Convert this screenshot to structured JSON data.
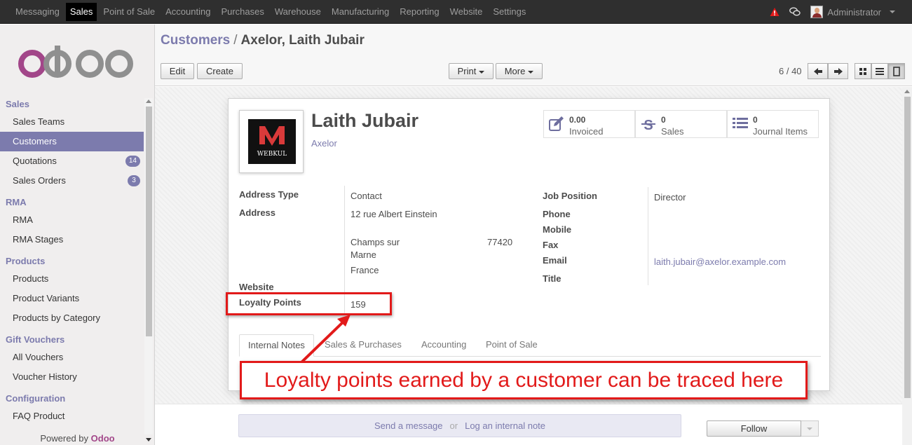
{
  "topbar": {
    "menus": [
      "Messaging",
      "Sales",
      "Point of Sale",
      "Accounting",
      "Purchases",
      "Warehouse",
      "Manufacturing",
      "Reporting",
      "Website",
      "Settings"
    ],
    "active_menu": "Sales",
    "user": "Administrator",
    "warning_color": "#e21a1a"
  },
  "sidebar": {
    "logo_text": "odoo",
    "sections": [
      {
        "title": "Sales",
        "items": [
          {
            "label": "Sales Teams"
          },
          {
            "label": "Customers",
            "active": true
          },
          {
            "label": "Quotations",
            "badge": "14"
          },
          {
            "label": "Sales Orders",
            "badge": "3"
          }
        ]
      },
      {
        "title": "RMA",
        "items": [
          {
            "label": "RMA"
          },
          {
            "label": "RMA Stages"
          }
        ]
      },
      {
        "title": "Products",
        "items": [
          {
            "label": "Products"
          },
          {
            "label": "Product Variants"
          },
          {
            "label": "Products by Category"
          }
        ]
      },
      {
        "title": "Gift Vouchers",
        "items": [
          {
            "label": "All Vouchers"
          },
          {
            "label": "Voucher History"
          }
        ]
      },
      {
        "title": "Configuration",
        "items": [
          {
            "label": "FAQ Product"
          }
        ]
      }
    ],
    "powered_by": "Powered by",
    "powered_brand": "Odoo"
  },
  "control_panel": {
    "breadcrumb_parent": "Customers",
    "breadcrumb_sep": "/",
    "breadcrumb_current": "Axelor, Laith Jubair",
    "edit_label": "Edit",
    "create_label": "Create",
    "print_label": "Print",
    "more_label": "More",
    "pager": "6 / 40"
  },
  "form": {
    "name": "Laith Jubair",
    "company": "Axelor",
    "photo_text": "WEBKUL",
    "stats": {
      "invoiced_value": "0.00",
      "invoiced_label": "Invoiced",
      "sales_value": "0",
      "sales_label": "Sales",
      "journal_value": "0",
      "journal_label": "Journal Items"
    },
    "left": {
      "address_type_label": "Address Type",
      "address_type_value": "Contact",
      "address_label": "Address",
      "street": "12 rue Albert Einstein",
      "city_line1": "Champs sur",
      "city_line2": "Marne",
      "zip": "77420",
      "country": "France",
      "website_label": "Website",
      "loyalty_label": "Loyalty Points",
      "loyalty_value": "159"
    },
    "right": {
      "job_label": "Job Position",
      "job_value": "Director",
      "phone_label": "Phone",
      "mobile_label": "Mobile",
      "fax_label": "Fax",
      "email_label": "Email",
      "email_value": "laith.jubair@axelor.example.com",
      "title_label": "Title"
    },
    "tabs": [
      "Internal Notes",
      "Sales & Purchases",
      "Accounting",
      "Point of Sale"
    ]
  },
  "chatter": {
    "send_message": "Send a message",
    "or": "or",
    "log_note": "Log an internal note",
    "follow_label": "Follow"
  },
  "annotation": {
    "callout_text": "Loyalty points earned by a customer can be traced here",
    "color": "#e21a1a"
  }
}
